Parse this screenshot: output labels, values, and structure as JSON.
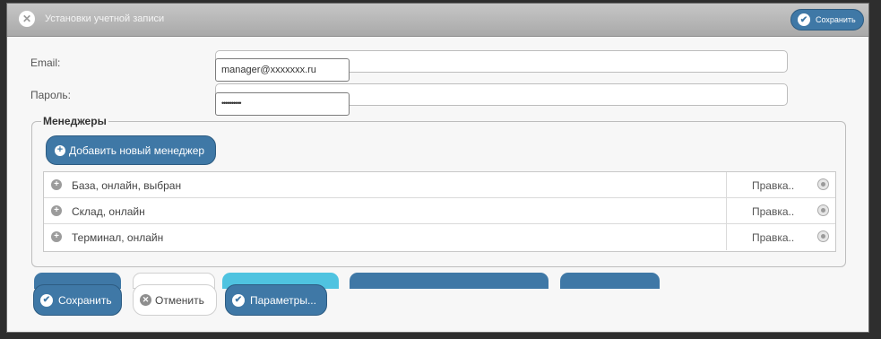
{
  "window": {
    "title": "Установки учетной записи",
    "top_save_label": "Сохранить"
  },
  "form": {
    "email_label": "Email:",
    "email_value": "manager@xxxxxxx.ru",
    "password_label": "Пароль:",
    "password_value": "••••••••••"
  },
  "managers": {
    "legend": "Менеджеры",
    "add_label": "Добавить новый менеджер",
    "rows": [
      {
        "name": "База, онлайн, выбран",
        "edit": "Правка.."
      },
      {
        "name": "Склад, онлайн",
        "edit": "Правка.."
      },
      {
        "name": "Терминал, онлайн",
        "edit": "Правка.."
      }
    ]
  },
  "footer": {
    "save_label": "Сохранить",
    "cancel_label": "Отменить",
    "params_label": "Параметры..."
  },
  "colors": {
    "accent": "#3f78a6",
    "ghost_cyan": "#4fc3e0"
  },
  "icons": [
    "close-icon",
    "check-icon",
    "plus-icon",
    "remove-icon",
    "cancel-icon"
  ]
}
